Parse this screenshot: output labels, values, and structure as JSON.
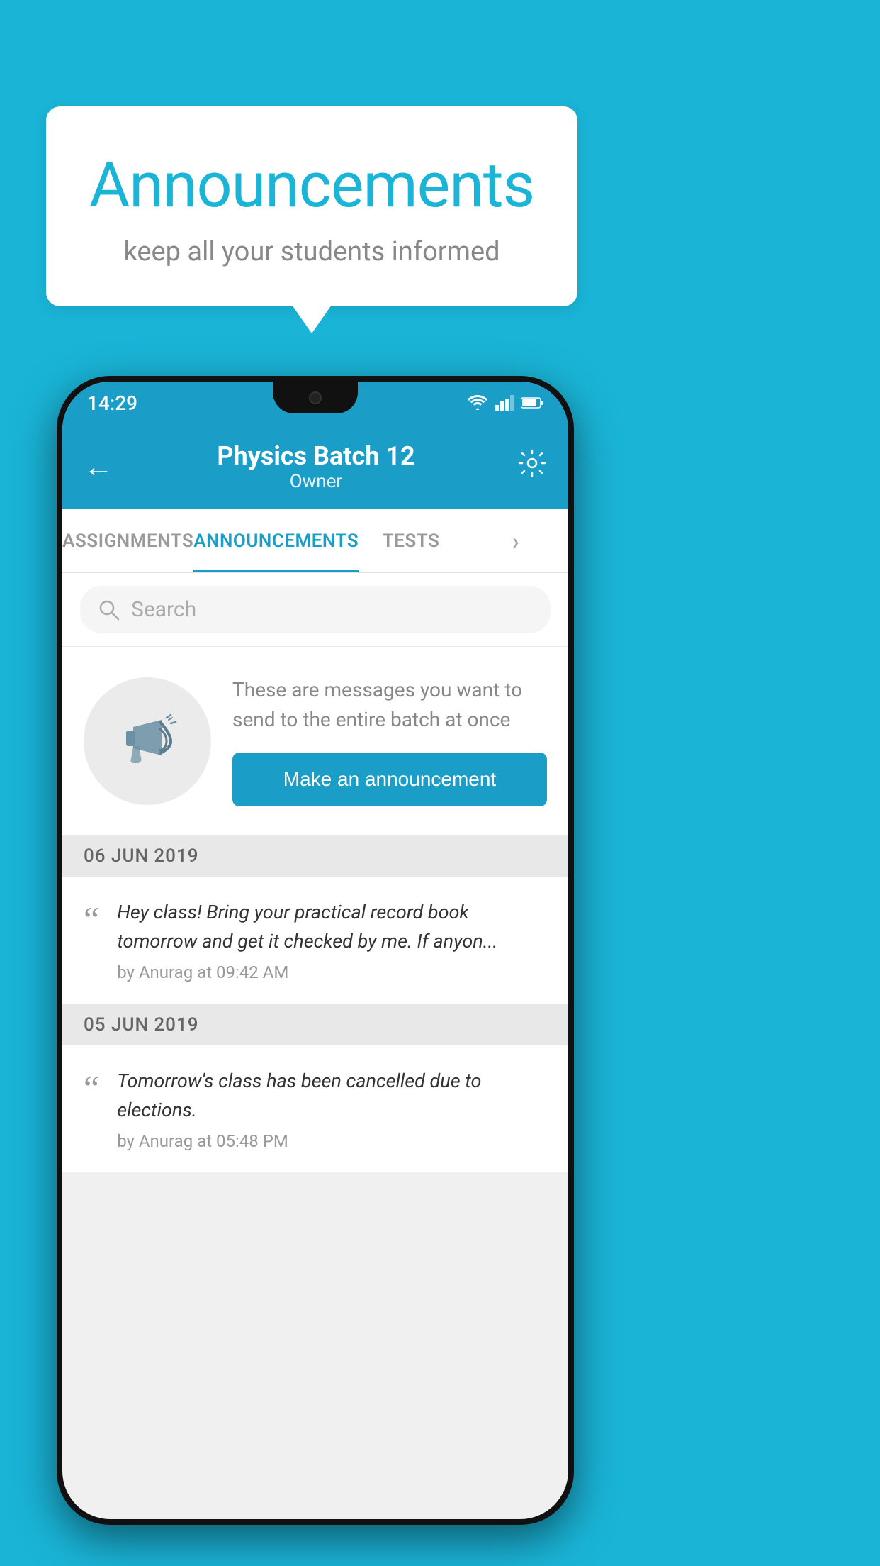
{
  "background_color": "#1ab4d7",
  "speech_bubble": {
    "title": "Announcements",
    "subtitle": "keep all your students informed"
  },
  "status_bar": {
    "time": "14:29",
    "wifi_icon": "wifi",
    "signal_icon": "signal",
    "battery_icon": "battery"
  },
  "app_header": {
    "batch_name": "Physics Batch 12",
    "role": "Owner",
    "back_label": "back",
    "settings_label": "settings"
  },
  "tabs": [
    {
      "label": "ASSIGNMENTS",
      "active": false
    },
    {
      "label": "ANNOUNCEMENTS",
      "active": true
    },
    {
      "label": "TESTS",
      "active": false
    },
    {
      "label": "MORE",
      "active": false
    }
  ],
  "search": {
    "placeholder": "Search"
  },
  "cta_section": {
    "description": "These are messages you want to send to the entire batch at once",
    "button_label": "Make an announcement"
  },
  "announcements": [
    {
      "date": "06  JUN  2019",
      "message": "Hey class! Bring your practical record book tomorrow and get it checked by me. If anyon...",
      "meta": "by Anurag at 09:42 AM"
    },
    {
      "date": "05  JUN  2019",
      "message": "Tomorrow's class has been cancelled due to elections.",
      "meta": "by Anurag at 05:48 PM"
    }
  ]
}
